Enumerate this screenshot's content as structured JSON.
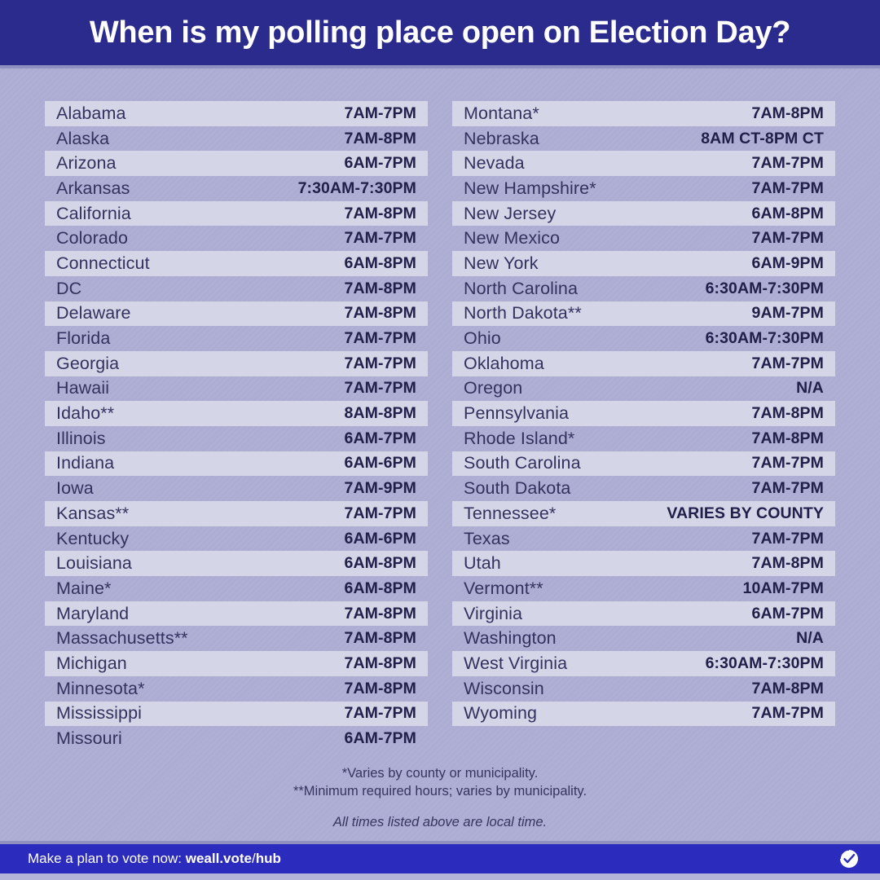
{
  "header": {
    "title": "When is my polling place open on Election Day?"
  },
  "colors": {
    "header_bar": "#2b2b8e",
    "page_background": "#adadd4",
    "row_stripe": "#d5d5e8",
    "state_text": "#32325e",
    "hours_text": "#20204a",
    "footer_bar": "#2b2bbe",
    "footer_text": "#ffffff"
  },
  "table": {
    "columns": [
      {
        "name": "left-column",
        "rows": [
          {
            "state": "Alabama",
            "hours": "7AM-7PM",
            "striped": true
          },
          {
            "state": "Alaska",
            "hours": "7AM-8PM",
            "striped": false
          },
          {
            "state": "Arizona",
            "hours": "6AM-7PM",
            "striped": true
          },
          {
            "state": "Arkansas",
            "hours": "7:30AM-7:30PM",
            "striped": false
          },
          {
            "state": "California",
            "hours": "7AM-8PM",
            "striped": true
          },
          {
            "state": "Colorado",
            "hours": "7AM-7PM",
            "striped": false
          },
          {
            "state": "Connecticut",
            "hours": "6AM-8PM",
            "striped": true
          },
          {
            "state": "DC",
            "hours": "7AM-8PM",
            "striped": false
          },
          {
            "state": "Delaware",
            "hours": "7AM-8PM",
            "striped": true
          },
          {
            "state": "Florida",
            "hours": "7AM-7PM",
            "striped": false
          },
          {
            "state": "Georgia",
            "hours": "7AM-7PM",
            "striped": true
          },
          {
            "state": "Hawaii",
            "hours": "7AM-7PM",
            "striped": false
          },
          {
            "state": "Idaho**",
            "hours": "8AM-8PM",
            "striped": true
          },
          {
            "state": "Illinois",
            "hours": "6AM-7PM",
            "striped": false
          },
          {
            "state": "Indiana",
            "hours": "6AM-6PM",
            "striped": true
          },
          {
            "state": "Iowa",
            "hours": "7AM-9PM",
            "striped": false
          },
          {
            "state": "Kansas**",
            "hours": "7AM-7PM",
            "striped": true
          },
          {
            "state": "Kentucky",
            "hours": "6AM-6PM",
            "striped": false
          },
          {
            "state": "Louisiana",
            "hours": "6AM-8PM",
            "striped": true
          },
          {
            "state": "Maine*",
            "hours": "6AM-8PM",
            "striped": false
          },
          {
            "state": "Maryland",
            "hours": "7AM-8PM",
            "striped": true
          },
          {
            "state": "Massachusetts**",
            "hours": "7AM-8PM",
            "striped": false
          },
          {
            "state": "Michigan",
            "hours": "7AM-8PM",
            "striped": true
          },
          {
            "state": "Minnesota*",
            "hours": "7AM-8PM",
            "striped": false
          },
          {
            "state": "Mississippi",
            "hours": "7AM-7PM",
            "striped": true
          },
          {
            "state": "Missouri",
            "hours": "6AM-7PM",
            "striped": false
          }
        ]
      },
      {
        "name": "right-column",
        "rows": [
          {
            "state": "Montana*",
            "hours": "7AM-8PM",
            "striped": true
          },
          {
            "state": "Nebraska",
            "hours": "8AM CT-8PM CT",
            "striped": false
          },
          {
            "state": "Nevada",
            "hours": "7AM-7PM",
            "striped": true
          },
          {
            "state": "New Hampshire*",
            "hours": "7AM-7PM",
            "striped": false
          },
          {
            "state": "New Jersey",
            "hours": "6AM-8PM",
            "striped": true
          },
          {
            "state": "New Mexico",
            "hours": "7AM-7PM",
            "striped": false
          },
          {
            "state": "New York",
            "hours": "6AM-9PM",
            "striped": true
          },
          {
            "state": "North Carolina",
            "hours": "6:30AM-7:30PM",
            "striped": false
          },
          {
            "state": "North Dakota**",
            "hours": "9AM-7PM",
            "striped": true
          },
          {
            "state": "Ohio",
            "hours": "6:30AM-7:30PM",
            "striped": false
          },
          {
            "state": "Oklahoma",
            "hours": "7AM-7PM",
            "striped": true
          },
          {
            "state": "Oregon",
            "hours": "N/A",
            "striped": false
          },
          {
            "state": "Pennsylvania",
            "hours": "7AM-8PM",
            "striped": true
          },
          {
            "state": "Rhode Island*",
            "hours": "7AM-8PM",
            "striped": false
          },
          {
            "state": "South Carolina",
            "hours": "7AM-7PM",
            "striped": true
          },
          {
            "state": "South Dakota",
            "hours": "7AM-7PM",
            "striped": false
          },
          {
            "state": "Tennessee*",
            "hours": "VARIES BY COUNTY",
            "striped": true
          },
          {
            "state": "Texas",
            "hours": "7AM-7PM",
            "striped": false
          },
          {
            "state": "Utah",
            "hours": "7AM-8PM",
            "striped": true
          },
          {
            "state": "Vermont**",
            "hours": "10AM-7PM",
            "striped": false
          },
          {
            "state": "Virginia",
            "hours": "6AM-7PM",
            "striped": true
          },
          {
            "state": "Washington",
            "hours": "N/A",
            "striped": false
          },
          {
            "state": "West Virginia",
            "hours": "6:30AM-7:30PM",
            "striped": true
          },
          {
            "state": "Wisconsin",
            "hours": "7AM-8PM",
            "striped": false
          },
          {
            "state": "Wyoming",
            "hours": "7AM-7PM",
            "striped": true
          }
        ]
      }
    ]
  },
  "footnotes": {
    "line1": "*Varies by county or municipality.",
    "line2": "**Minimum required hours; varies by municipality.",
    "line3": "All times listed above are local time."
  },
  "footer": {
    "prefix": "Make a plan to vote now: ",
    "url_bold": "weall.vote",
    "url_slash": "/",
    "url_bold2": "hub",
    "logo": "check-circle-icon"
  }
}
